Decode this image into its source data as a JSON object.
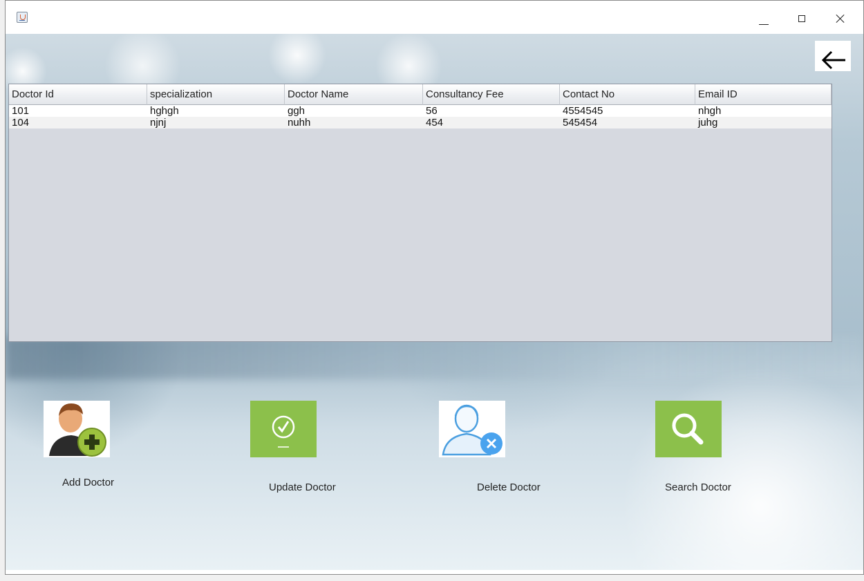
{
  "window": {
    "app_icon": "java-app-icon",
    "controls": [
      "minimize-icon",
      "maximize-icon",
      "close-icon"
    ]
  },
  "back_icon": "arrow-left-icon",
  "table": {
    "columns": [
      "Doctor Id",
      "specialization",
      "Doctor Name",
      "Consultancy Fee",
      "Contact No",
      "Email ID"
    ],
    "rows": [
      [
        "101",
        "hghgh",
        "ggh",
        "56",
        "4554545",
        "nhgh"
      ],
      [
        "104",
        "njnj",
        "nuhh",
        "454",
        "545454",
        "juhg"
      ]
    ]
  },
  "actions": {
    "add": {
      "label": "Add Doctor",
      "icon": "add-user-icon"
    },
    "update": {
      "label": "Update Doctor",
      "icon": "checkmark-icon"
    },
    "delete": {
      "label": "Delete Doctor",
      "icon": "remove-user-icon"
    },
    "search": {
      "label": "Search Doctor",
      "icon": "search-icon"
    }
  },
  "colors": {
    "green": "#8cc04b",
    "blue_user": "#4b9fe0",
    "remove_badge": "#4aa3ee"
  }
}
